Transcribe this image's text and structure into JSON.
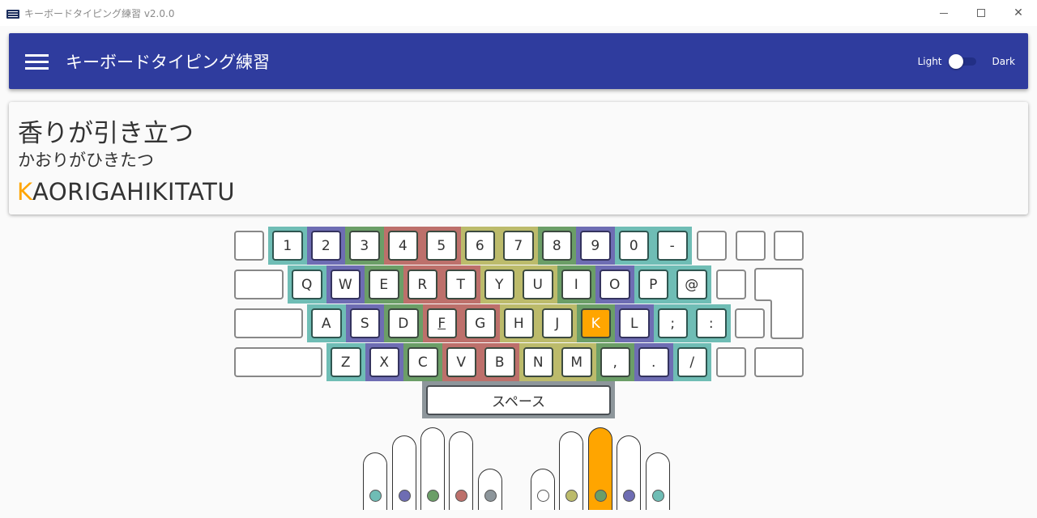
{
  "window": {
    "title": "キーボードタイピング練習 v2.0.0",
    "icon": "keyboard-icon",
    "controls": [
      "minimize-icon",
      "maximize-icon",
      "close-icon"
    ]
  },
  "appbar": {
    "menu_icon": "hamburger-menu-icon",
    "title": "キーボードタイピング練習",
    "theme_toggle": {
      "left_label": "Light",
      "right_label": "Dark",
      "state": "Light"
    }
  },
  "prompt": {
    "kanji": "香りが引き立つ",
    "kana": "かおりがひきたつ",
    "romaji_typed": "K",
    "romaji_remaining": "AORIGAHIKITATU",
    "typed_color": "#ffa500"
  },
  "colors": {
    "pinky": "#6fbdb5",
    "ring": "#6e6db3",
    "middle": "#6b9e67",
    "index_left": "#bd706b",
    "index_right": "#bcbb6b",
    "thumb": "#8d969b",
    "active": "#ffa500"
  },
  "keyboard": {
    "active_key": "K",
    "rows": [
      {
        "keys": [
          {
            "label": "",
            "finger": "none"
          },
          {
            "label": "1",
            "finger": "pinky"
          },
          {
            "label": "2",
            "finger": "ring"
          },
          {
            "label": "3",
            "finger": "middle"
          },
          {
            "label": "4",
            "finger": "index_left"
          },
          {
            "label": "5",
            "finger": "index_left"
          },
          {
            "label": "6",
            "finger": "index_right"
          },
          {
            "label": "7",
            "finger": "index_right"
          },
          {
            "label": "8",
            "finger": "middle"
          },
          {
            "label": "9",
            "finger": "ring"
          },
          {
            "label": "0",
            "finger": "pinky"
          },
          {
            "label": "-",
            "finger": "pinky"
          },
          {
            "label": "",
            "finger": "none"
          },
          {
            "label": "",
            "finger": "none"
          },
          {
            "label": "",
            "finger": "none"
          }
        ]
      },
      {
        "keys": [
          {
            "label": "",
            "finger": "none"
          },
          {
            "label": "Q",
            "finger": "pinky"
          },
          {
            "label": "W",
            "finger": "ring"
          },
          {
            "label": "E",
            "finger": "middle"
          },
          {
            "label": "R",
            "finger": "index_left"
          },
          {
            "label": "T",
            "finger": "index_left"
          },
          {
            "label": "Y",
            "finger": "index_right"
          },
          {
            "label": "U",
            "finger": "index_right"
          },
          {
            "label": "I",
            "finger": "middle"
          },
          {
            "label": "O",
            "finger": "ring"
          },
          {
            "label": "P",
            "finger": "pinky"
          },
          {
            "label": "@",
            "finger": "pinky"
          },
          {
            "label": "",
            "finger": "none"
          }
        ]
      },
      {
        "keys": [
          {
            "label": "",
            "finger": "none"
          },
          {
            "label": "A",
            "finger": "pinky"
          },
          {
            "label": "S",
            "finger": "ring"
          },
          {
            "label": "D",
            "finger": "middle"
          },
          {
            "label": "F",
            "finger": "index_left",
            "home": true
          },
          {
            "label": "G",
            "finger": "index_left"
          },
          {
            "label": "H",
            "finger": "index_right"
          },
          {
            "label": "J",
            "finger": "index_right",
            "home": true
          },
          {
            "label": "K",
            "finger": "middle"
          },
          {
            "label": "L",
            "finger": "ring"
          },
          {
            "label": ";",
            "finger": "pinky"
          },
          {
            "label": ":",
            "finger": "pinky"
          },
          {
            "label": "",
            "finger": "none"
          }
        ]
      },
      {
        "keys": [
          {
            "label": "",
            "finger": "none"
          },
          {
            "label": "Z",
            "finger": "pinky"
          },
          {
            "label": "X",
            "finger": "ring"
          },
          {
            "label": "C",
            "finger": "middle"
          },
          {
            "label": "V",
            "finger": "index_left"
          },
          {
            "label": "B",
            "finger": "index_left"
          },
          {
            "label": "N",
            "finger": "index_right"
          },
          {
            "label": "M",
            "finger": "index_right"
          },
          {
            "label": ",",
            "finger": "middle"
          },
          {
            "label": ".",
            "finger": "ring"
          },
          {
            "label": "/",
            "finger": "pinky"
          },
          {
            "label": "",
            "finger": "none"
          },
          {
            "label": "",
            "finger": "none"
          }
        ]
      }
    ],
    "space_label": "スペース"
  },
  "hands": {
    "left": [
      {
        "finger": "pinky",
        "dot": "#6fbdb5"
      },
      {
        "finger": "ring",
        "dot": "#6e6db3"
      },
      {
        "finger": "middle",
        "dot": "#6b9e67"
      },
      {
        "finger": "index",
        "dot": "#bd706b"
      },
      {
        "finger": "thumb",
        "dot": "#8d969b"
      }
    ],
    "right": [
      {
        "finger": "thumb",
        "dot": "#ffffff"
      },
      {
        "finger": "index",
        "dot": "#bcbb6b"
      },
      {
        "finger": "middle",
        "dot": "#6b9e67",
        "active": true
      },
      {
        "finger": "ring",
        "dot": "#6e6db3"
      },
      {
        "finger": "pinky",
        "dot": "#6fbdb5"
      }
    ]
  }
}
